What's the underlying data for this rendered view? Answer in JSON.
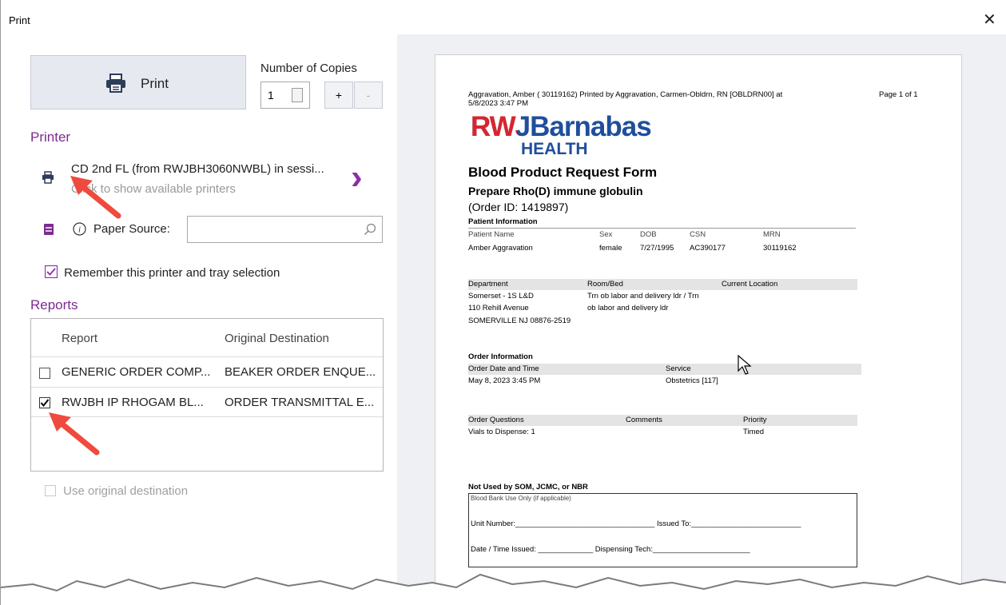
{
  "window": {
    "title": "Print",
    "close_glyph": "✕"
  },
  "print_button": {
    "label": "Print"
  },
  "copies": {
    "label": "Number of Copies",
    "value": "1",
    "plus": "+",
    "minus": "-"
  },
  "printer_section": {
    "heading": "Printer",
    "printer_name": "CD 2nd FL (from RWJBH3060NWBL) in sessi...",
    "hint": "Click to show available printers",
    "chevron": "›",
    "paper_source_label": "Paper Source:",
    "paper_source_value": "",
    "remember_label": "Remember this printer and tray selection",
    "remember_checked": true
  },
  "reports_section": {
    "heading": "Reports",
    "columns": [
      "Report",
      "Original Destination"
    ],
    "rows": [
      {
        "checked": false,
        "report": "GENERIC ORDER COMP...",
        "destination": "BEAKER ORDER ENQUE..."
      },
      {
        "checked": true,
        "report": "RWJBH IP RHOGAM BL...",
        "destination": "ORDER TRANSMITTAL E..."
      }
    ],
    "use_original_label": "Use original destination"
  },
  "preview": {
    "header_line1": "Aggravation, Amber ( 30119162) Printed by Aggravation, Carmen-Obldrn, RN [OBLDRN00] at",
    "header_line2": "5/8/2023  3:47 PM",
    "page_num": "Page 1 of 1",
    "logo_line1": "RWJBarnabas",
    "logo_line2": "HEALTH",
    "form_title": "Blood Product Request Form",
    "subtitle": "Prepare Rho(D) immune globulin",
    "order_id": "(Order ID: 1419897)",
    "patient_info_heading": "Patient Information",
    "patient_cols": [
      "Patient Name",
      "Sex",
      "DOB",
      "CSN",
      "MRN"
    ],
    "patient_vals": [
      "Amber Aggravation",
      "female",
      "7/27/1995",
      "AC390177",
      "30119162"
    ],
    "dept_cols": [
      "Department",
      "Room/Bed",
      "Current Location"
    ],
    "dept_lines": [
      "Somerset - 1S L&D",
      "110 Rehill Avenue",
      "SOMERVILLE NJ 08876-2519"
    ],
    "room_lines": [
      "Trn ob labor and delivery ldr / Trn",
      "ob labor and delivery ldr"
    ],
    "order_info_heading": "Order Information",
    "order_cols": [
      "Order Date and Time",
      "Service"
    ],
    "order_vals": [
      "May 8, 2023 3:45 PM",
      "Obstetrics [117]"
    ],
    "question_cols": [
      "Order Questions",
      "Comments",
      "Priority"
    ],
    "question_vals": [
      "Vials to Dispense: 1",
      "Timed"
    ],
    "not_used_heading": "Not Used by SOM, JCMC, or NBR",
    "bb_note": "Blood Bank Use Only (if applicable)",
    "unit_line": "Unit Number:_________________________________   Issued To:__________________________",
    "date_line": "Date / Time Issued: _____________   Dispensing Tech:_______________________"
  },
  "colors": {
    "accent": "#7b2c8f",
    "logo_red": "#d8262e",
    "logo_blue": "#1f4e9c",
    "arrow": "#ee4b3e"
  }
}
